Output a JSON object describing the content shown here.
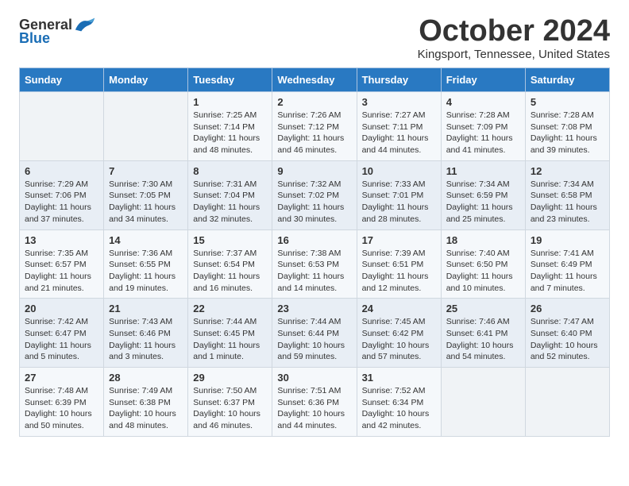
{
  "header": {
    "logo_general": "General",
    "logo_blue": "Blue",
    "month": "October 2024",
    "location": "Kingsport, Tennessee, United States"
  },
  "weekdays": [
    "Sunday",
    "Monday",
    "Tuesday",
    "Wednesday",
    "Thursday",
    "Friday",
    "Saturday"
  ],
  "weeks": [
    [
      {
        "day": "",
        "empty": true
      },
      {
        "day": "",
        "empty": true
      },
      {
        "day": "1",
        "sunrise": "7:25 AM",
        "sunset": "7:14 PM",
        "daylight": "11 hours and 48 minutes."
      },
      {
        "day": "2",
        "sunrise": "7:26 AM",
        "sunset": "7:12 PM",
        "daylight": "11 hours and 46 minutes."
      },
      {
        "day": "3",
        "sunrise": "7:27 AM",
        "sunset": "7:11 PM",
        "daylight": "11 hours and 44 minutes."
      },
      {
        "day": "4",
        "sunrise": "7:28 AM",
        "sunset": "7:09 PM",
        "daylight": "11 hours and 41 minutes."
      },
      {
        "day": "5",
        "sunrise": "7:28 AM",
        "sunset": "7:08 PM",
        "daylight": "11 hours and 39 minutes."
      }
    ],
    [
      {
        "day": "6",
        "sunrise": "7:29 AM",
        "sunset": "7:06 PM",
        "daylight": "11 hours and 37 minutes."
      },
      {
        "day": "7",
        "sunrise": "7:30 AM",
        "sunset": "7:05 PM",
        "daylight": "11 hours and 34 minutes."
      },
      {
        "day": "8",
        "sunrise": "7:31 AM",
        "sunset": "7:04 PM",
        "daylight": "11 hours and 32 minutes."
      },
      {
        "day": "9",
        "sunrise": "7:32 AM",
        "sunset": "7:02 PM",
        "daylight": "11 hours and 30 minutes."
      },
      {
        "day": "10",
        "sunrise": "7:33 AM",
        "sunset": "7:01 PM",
        "daylight": "11 hours and 28 minutes."
      },
      {
        "day": "11",
        "sunrise": "7:34 AM",
        "sunset": "6:59 PM",
        "daylight": "11 hours and 25 minutes."
      },
      {
        "day": "12",
        "sunrise": "7:34 AM",
        "sunset": "6:58 PM",
        "daylight": "11 hours and 23 minutes."
      }
    ],
    [
      {
        "day": "13",
        "sunrise": "7:35 AM",
        "sunset": "6:57 PM",
        "daylight": "11 hours and 21 minutes."
      },
      {
        "day": "14",
        "sunrise": "7:36 AM",
        "sunset": "6:55 PM",
        "daylight": "11 hours and 19 minutes."
      },
      {
        "day": "15",
        "sunrise": "7:37 AM",
        "sunset": "6:54 PM",
        "daylight": "11 hours and 16 minutes."
      },
      {
        "day": "16",
        "sunrise": "7:38 AM",
        "sunset": "6:53 PM",
        "daylight": "11 hours and 14 minutes."
      },
      {
        "day": "17",
        "sunrise": "7:39 AM",
        "sunset": "6:51 PM",
        "daylight": "11 hours and 12 minutes."
      },
      {
        "day": "18",
        "sunrise": "7:40 AM",
        "sunset": "6:50 PM",
        "daylight": "11 hours and 10 minutes."
      },
      {
        "day": "19",
        "sunrise": "7:41 AM",
        "sunset": "6:49 PM",
        "daylight": "11 hours and 7 minutes."
      }
    ],
    [
      {
        "day": "20",
        "sunrise": "7:42 AM",
        "sunset": "6:47 PM",
        "daylight": "11 hours and 5 minutes."
      },
      {
        "day": "21",
        "sunrise": "7:43 AM",
        "sunset": "6:46 PM",
        "daylight": "11 hours and 3 minutes."
      },
      {
        "day": "22",
        "sunrise": "7:44 AM",
        "sunset": "6:45 PM",
        "daylight": "11 hours and 1 minute."
      },
      {
        "day": "23",
        "sunrise": "7:44 AM",
        "sunset": "6:44 PM",
        "daylight": "10 hours and 59 minutes."
      },
      {
        "day": "24",
        "sunrise": "7:45 AM",
        "sunset": "6:42 PM",
        "daylight": "10 hours and 57 minutes."
      },
      {
        "day": "25",
        "sunrise": "7:46 AM",
        "sunset": "6:41 PM",
        "daylight": "10 hours and 54 minutes."
      },
      {
        "day": "26",
        "sunrise": "7:47 AM",
        "sunset": "6:40 PM",
        "daylight": "10 hours and 52 minutes."
      }
    ],
    [
      {
        "day": "27",
        "sunrise": "7:48 AM",
        "sunset": "6:39 PM",
        "daylight": "10 hours and 50 minutes."
      },
      {
        "day": "28",
        "sunrise": "7:49 AM",
        "sunset": "6:38 PM",
        "daylight": "10 hours and 48 minutes."
      },
      {
        "day": "29",
        "sunrise": "7:50 AM",
        "sunset": "6:37 PM",
        "daylight": "10 hours and 46 minutes."
      },
      {
        "day": "30",
        "sunrise": "7:51 AM",
        "sunset": "6:36 PM",
        "daylight": "10 hours and 44 minutes."
      },
      {
        "day": "31",
        "sunrise": "7:52 AM",
        "sunset": "6:34 PM",
        "daylight": "10 hours and 42 minutes."
      },
      {
        "day": "",
        "empty": true
      },
      {
        "day": "",
        "empty": true
      }
    ]
  ]
}
